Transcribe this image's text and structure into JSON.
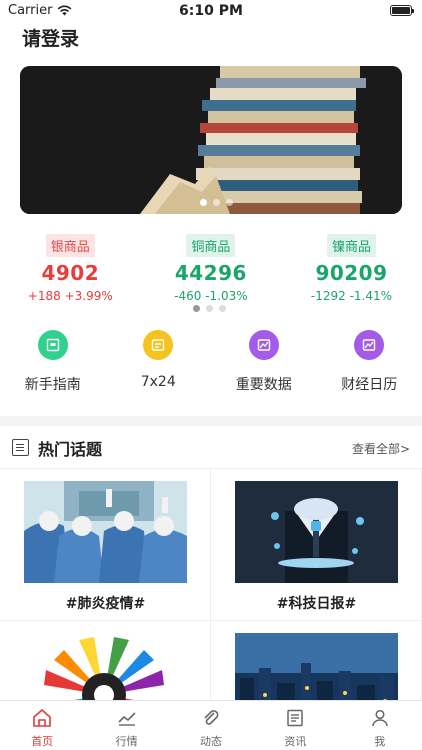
{
  "status_bar": {
    "carrier": "Carrier",
    "time": "6:10 PM"
  },
  "header": {
    "login_label": "请登录"
  },
  "quotes": [
    {
      "name": "银商品",
      "price": "4902",
      "change": "+188 +3.99%",
      "trend": "up"
    },
    {
      "name": "铜商品",
      "price": "44296",
      "change": "-460 -1.03%",
      "trend": "down"
    },
    {
      "name": "镍商品",
      "price": "90209",
      "change": "-1292 -1.41%",
      "trend": "down"
    }
  ],
  "quick_menu": [
    {
      "label": "新手指南",
      "icon": "guide-icon",
      "color": "#2fd18f"
    },
    {
      "label": "7x24",
      "icon": "calendar-icon",
      "color": "#f5c31e"
    },
    {
      "label": "重要数据",
      "icon": "chart-icon",
      "color": "#a25ce8"
    },
    {
      "label": "财经日历",
      "icon": "finance-calendar-icon",
      "color": "#a25ce8"
    }
  ],
  "hot_topics": {
    "title": "热门话题",
    "more_label": "查看全部>",
    "items": [
      {
        "caption": "#肺炎疫情#"
      },
      {
        "caption": "#科技日报#"
      },
      {
        "caption": ""
      },
      {
        "caption": ""
      }
    ]
  },
  "tab_bar": [
    {
      "label": "首页",
      "icon": "home-icon",
      "active": true
    },
    {
      "label": "行情",
      "icon": "trend-icon",
      "active": false
    },
    {
      "label": "动态",
      "icon": "paperclip-icon",
      "active": false
    },
    {
      "label": "资讯",
      "icon": "news-icon",
      "active": false
    },
    {
      "label": "我",
      "icon": "user-icon",
      "active": false
    }
  ],
  "colors": {
    "accent": "#e03c3c",
    "up": "#e83d3d",
    "down": "#1aa56b"
  }
}
